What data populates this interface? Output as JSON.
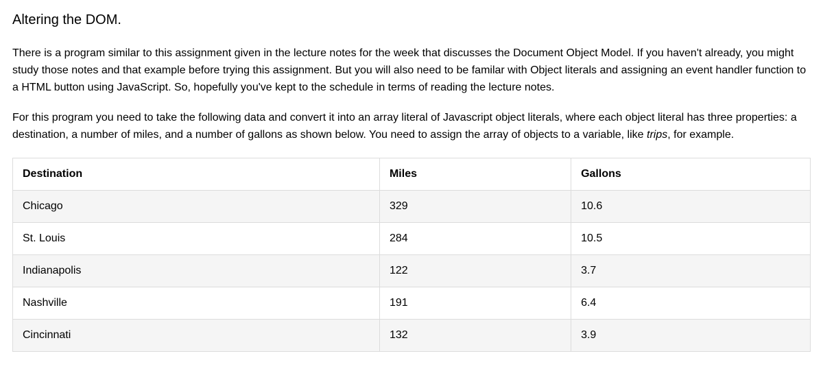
{
  "heading": "Altering the DOM.",
  "para1": "There is a program similar to this assignment given in the lecture notes for the week that discusses the Document Object Model. If you haven't already, you might study those notes and that example before trying this assignment. But you will also need to be familar with Object literals and assigning an event handler function to a HTML button using JavaScript. So, hopefully you've kept to the schedule in terms of reading the lecture notes.",
  "para2_a": "For this program you need to take the following data and convert it into an array literal of Javascript object literals, where each object literal has three properties: a destination, a number of miles, and a number of gallons as shown below. You need to assign the array of objects to a variable, like ",
  "para2_var": "trips",
  "para2_b": ", for example.",
  "table": {
    "headers": {
      "destination": "Destination",
      "miles": "Miles",
      "gallons": "Gallons"
    },
    "rows": [
      {
        "destination": "Chicago",
        "miles": "329",
        "gallons": "10.6"
      },
      {
        "destination": "St. Louis",
        "miles": "284",
        "gallons": "10.5"
      },
      {
        "destination": "Indianapolis",
        "miles": "122",
        "gallons": "3.7"
      },
      {
        "destination": "Nashville",
        "miles": "191",
        "gallons": "6.4"
      },
      {
        "destination": "Cincinnati",
        "miles": "132",
        "gallons": "3.9"
      }
    ]
  }
}
